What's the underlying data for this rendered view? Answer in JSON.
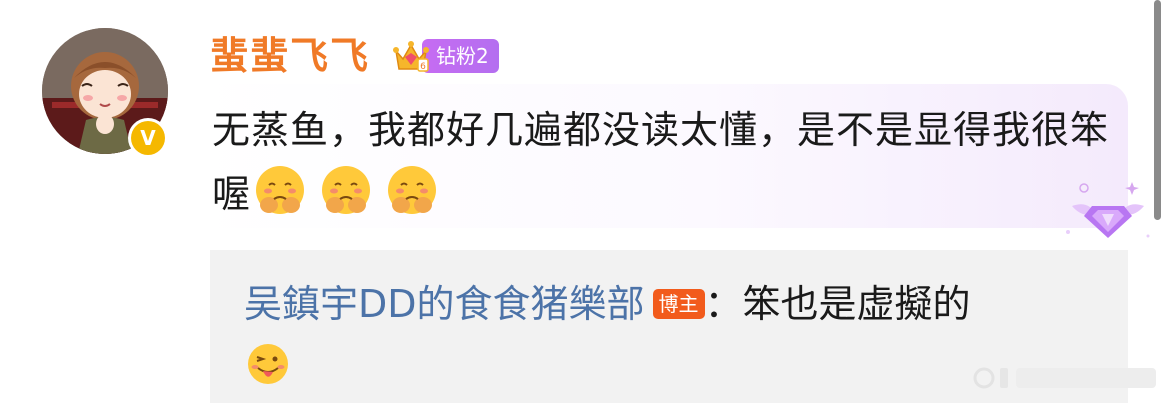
{
  "comment": {
    "username": "蜚蜚飞飞",
    "fan_badge": "钻粉2",
    "verified_mark": "V",
    "text": "无蒸鱼，我都好几遍都没读太懂，是不是显得我很笨喔",
    "emoji_icons": [
      "sad-face-emoji",
      "sad-face-emoji",
      "sad-face-emoji"
    ]
  },
  "reply": {
    "author": "吴鎮宇DD的食食猪樂部",
    "author_tag": "博主",
    "text": "：笨也是虚擬的",
    "emoji_icon": "tongue-wink-emoji"
  },
  "colors": {
    "username": "#f07a27",
    "fan_badge": "#b46ef0",
    "reply_author": "#4c73a8",
    "blogger_tag": "#f25b1c",
    "verified": "#f5b800"
  }
}
